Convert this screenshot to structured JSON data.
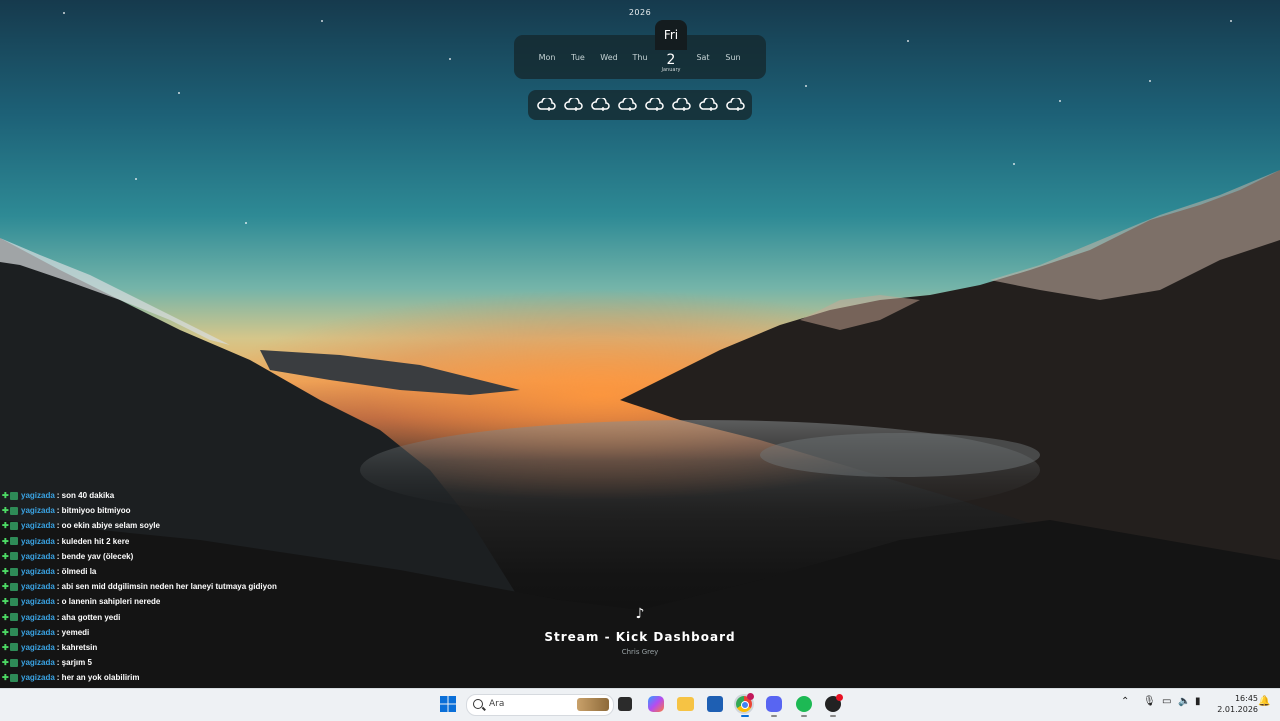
{
  "widget": {
    "year": "2026",
    "days": [
      "Mon",
      "Tue",
      "Wed",
      "Thu",
      "Sat",
      "Sun"
    ],
    "today": {
      "day": "Fri",
      "date": "2",
      "month": "January"
    }
  },
  "chat": {
    "messages": [
      {
        "user": "yagizada",
        "text": ": son 40 dakika"
      },
      {
        "user": "yagizada",
        "text": ": bitmiyoo bitmiyoo"
      },
      {
        "user": "yagizada",
        "text": ": oo ekin abiye selam soyle"
      },
      {
        "user": "yagizada",
        "text": ": kuleden hit 2 kere"
      },
      {
        "user": "yagizada",
        "text": ": bende yav (ölecek)"
      },
      {
        "user": "yagizada",
        "text": ": ölmedi la"
      },
      {
        "user": "yagizada",
        "text": ": abi sen mid ddgilimsin neden her laneyi tutmaya gidiyon"
      },
      {
        "user": "yagizada",
        "text": ": o lanenin sahipleri nerede"
      },
      {
        "user": "yagizada",
        "text": ": aha gotten yedi"
      },
      {
        "user": "yagizada",
        "text": ": yemedi"
      },
      {
        "user": "yagizada",
        "text": ": kahretsin"
      },
      {
        "user": "yagizada",
        "text": ": şarjım 5"
      },
      {
        "user": "yagizada",
        "text": ": her an yok olabilirim"
      }
    ]
  },
  "music": {
    "title": "Stream - Kick Dashboard",
    "artist": "Chris Grey"
  },
  "taskbar": {
    "search_placeholder": "Ara",
    "time": "16:45",
    "date": "2.01.2026"
  }
}
